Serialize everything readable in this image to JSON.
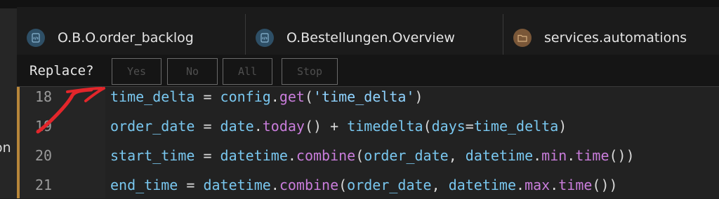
{
  "left_edge": {
    "partial_text": "on"
  },
  "tabs": [
    {
      "label": "O.B.O.order_backlog",
      "icon": "code-file-icon"
    },
    {
      "label": "O.Bestellungen.Overview",
      "icon": "code-file-icon"
    },
    {
      "label": "services.automations",
      "icon": "folder-icon"
    }
  ],
  "replace": {
    "label": "Replace?",
    "buttons": {
      "yes": "Yes",
      "no": "No",
      "all": "All",
      "stop": "Stop"
    }
  },
  "editor": {
    "lines": [
      {
        "number": "18"
      },
      {
        "number": "19"
      },
      {
        "number": "20"
      },
      {
        "number": "21"
      }
    ],
    "tokens": {
      "l18": {
        "a": "time_delta",
        "b": " = ",
        "c": "config",
        "d": ".",
        "e": "get",
        "f": "(",
        "g": "'time_delta'",
        "h": ")"
      },
      "l19": {
        "a": "order_date",
        "b": " = ",
        "c": "date",
        "d": ".",
        "e": "today",
        "f": "() + ",
        "g": "timedelta",
        "h": "(",
        "i": "days",
        "j": "=",
        "k": "time_delta",
        "l": ")"
      },
      "l20": {
        "a": "start_time",
        "b": " = ",
        "c": "datetime",
        "d": ".",
        "e": "combine",
        "f": "(",
        "g": "order_date",
        "h": ", ",
        "i": "datetime",
        "j": ".",
        "k": "min",
        "l": ".",
        "m": "time",
        "n": "())"
      },
      "l21": {
        "a": "end_time",
        "b": " = ",
        "c": "datetime",
        "d": ".",
        "e": "combine",
        "f": "(",
        "g": "order_date",
        "h": ", ",
        "i": "datetime",
        "j": ".",
        "k": "max",
        "l": ".",
        "m": "time",
        "n": "())"
      }
    }
  },
  "colors": {
    "annotation": "#e3262b",
    "accent_border": "#b7863a",
    "code_blue": "#79c7ef",
    "code_purple": "#c97ddb"
  }
}
